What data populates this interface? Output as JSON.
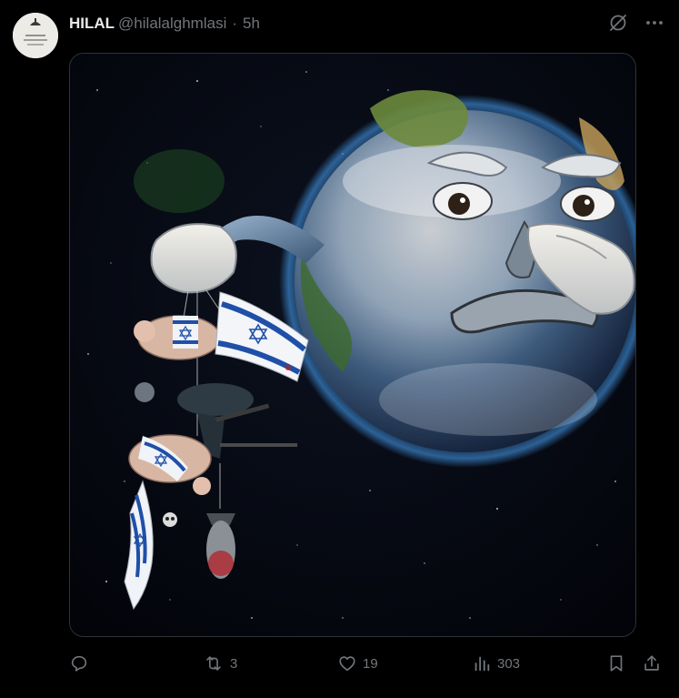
{
  "tweet": {
    "display_name": "HILAL",
    "handle": "@hilalalghmlasi",
    "separator": "·",
    "timestamp": "5h",
    "media": {
      "alt_icon": "image"
    }
  },
  "top_icons": [
    "grok-icon",
    "more-icon"
  ],
  "actions": {
    "reply_count": "",
    "retweet_count": "3",
    "like_count": "19",
    "views_count": "303"
  },
  "colors": {
    "background": "#000000",
    "text_primary": "#e7e9ea",
    "text_secondary": "#71767b",
    "border": "#2f3336"
  }
}
